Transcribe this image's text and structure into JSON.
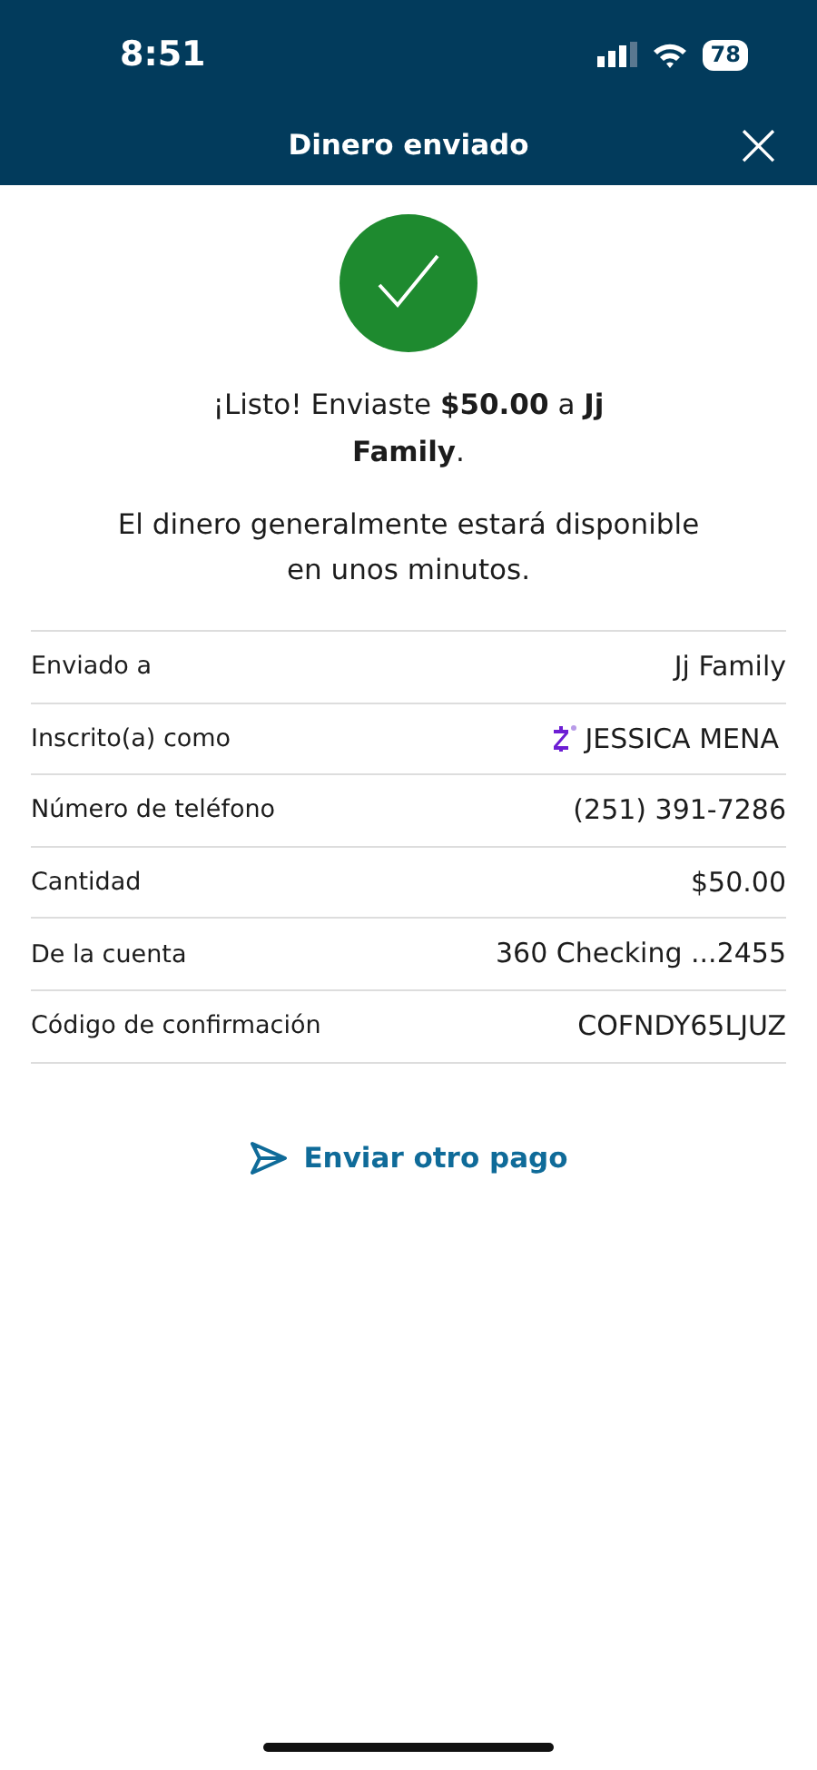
{
  "status_bar": {
    "time": "8:51",
    "battery": "78"
  },
  "header": {
    "title": "Dinero enviado",
    "close": "×"
  },
  "message": "¡Listo! Enviaste **$50.00** a **Jj Family**.",
  "note": "El dinero generalmente estará disponible en unos minutos.",
  "details": [
    {
      "label": "Enviado a",
      "value": "Jj Family",
      "kind": "plain"
    },
    {
      "label": "Inscrito(a) como",
      "value": "JESSICA MENA",
      "kind": "enrolled"
    },
    {
      "label": "Número de teléfono",
      "value": "(251) 391-7286",
      "kind": "plain"
    },
    {
      "label": "Cantidad",
      "value": "$50.00",
      "kind": "plain"
    },
    {
      "label": "De la cuenta",
      "value": "360 Checking ...2455",
      "kind": "plain"
    },
    {
      "label": "Código de confirmación",
      "value": "COFNDY65LJUZ",
      "kind": "plain"
    }
  ],
  "action": {
    "label": "Enviar otro pago"
  }
}
